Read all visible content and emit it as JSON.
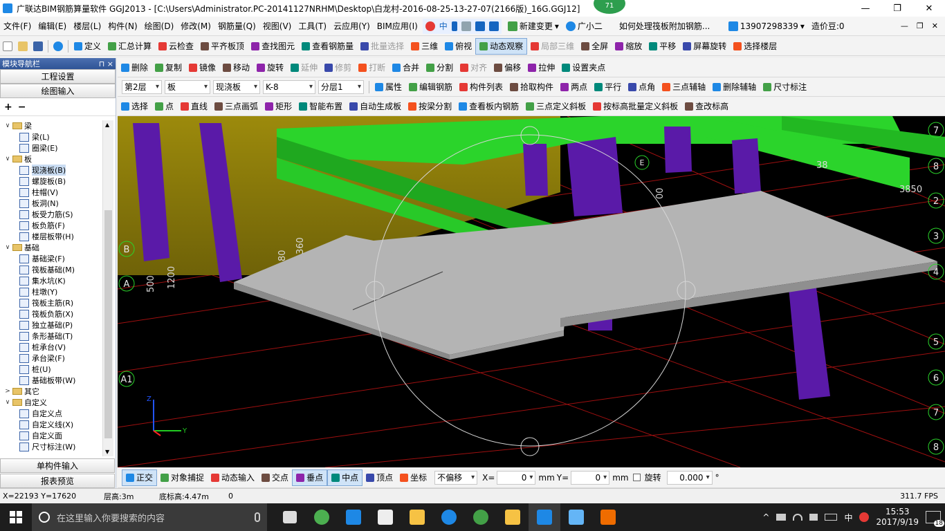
{
  "window": {
    "title": "广联达BIM钢筋算量软件 GGJ2013 - [C:\\Users\\Administrator.PC-20141127NRHM\\Desktop\\白龙村-2016-08-25-13-27-07(2166版)_16G.GGJ12]",
    "badge": "71"
  },
  "menu": {
    "items": [
      "文件(F)",
      "编辑(E)",
      "楼层(L)",
      "构件(N)",
      "绘图(D)",
      "修改(M)",
      "钢筋量(Q)",
      "视图(V)",
      "工具(T)",
      "云应用(Y)",
      "BIM应用(I)"
    ],
    "new_change": "新建变更",
    "assistant": "广小二",
    "question": "如何处理筏板附加钢筋...",
    "phone": "13907298339",
    "beans": "造价豆:0",
    "ime_label": "中"
  },
  "toolbar1": [
    "定义",
    "汇总计算",
    "云检查",
    "平齐板顶",
    "查找图元",
    "查看钢筋量",
    "批量选择",
    "三维",
    "俯视",
    "动态观察",
    "局部三维",
    "全屏",
    "缩放",
    "平移",
    "屏幕旋转",
    "选择楼层"
  ],
  "toolbar2": [
    "删除",
    "复制",
    "镜像",
    "移动",
    "旋转",
    "延伸",
    "修剪",
    "打断",
    "合并",
    "分割",
    "对齐",
    "偏移",
    "拉伸",
    "设置夹点"
  ],
  "toolbar3": {
    "floor": "第2层",
    "category": "板",
    "type": "现浇板",
    "name": "K-8",
    "layer": "分层1",
    "buttons": [
      "属性",
      "编辑钢筋",
      "构件列表",
      "拾取构件",
      "两点",
      "平行",
      "点角",
      "三点辅轴",
      "删除辅轴",
      "尺寸标注"
    ]
  },
  "toolbar4": [
    "选择",
    "点",
    "直线",
    "三点画弧",
    "矩形",
    "智能布置",
    "自动生成板",
    "按梁分割",
    "查看板内钢筋",
    "三点定义斜板",
    "按标高批量定义斜板",
    "查改标高"
  ],
  "nav": {
    "title": "模块导航栏",
    "pin": "⊓ ×",
    "project_settings": "工程设置",
    "drawing_input": "绘图输入",
    "single_input": "单构件输入",
    "report_preview": "报表预览",
    "tree": [
      {
        "level": 0,
        "label": "梁",
        "folder": true,
        "exp": "∨"
      },
      {
        "level": 1,
        "label": "梁(L)"
      },
      {
        "level": 1,
        "label": "圈梁(E)"
      },
      {
        "level": 0,
        "label": "板",
        "folder": true,
        "exp": "∨"
      },
      {
        "level": 1,
        "label": "现浇板(B)",
        "selected": true
      },
      {
        "level": 1,
        "label": "螺旋板(B)"
      },
      {
        "level": 1,
        "label": "柱帽(V)"
      },
      {
        "level": 1,
        "label": "板洞(N)"
      },
      {
        "level": 1,
        "label": "板受力筋(S)"
      },
      {
        "level": 1,
        "label": "板负筋(F)"
      },
      {
        "level": 1,
        "label": "楼层板带(H)"
      },
      {
        "level": 0,
        "label": "基础",
        "folder": true,
        "exp": "∨"
      },
      {
        "level": 1,
        "label": "基础梁(F)"
      },
      {
        "level": 1,
        "label": "筏板基础(M)"
      },
      {
        "level": 1,
        "label": "集水坑(K)"
      },
      {
        "level": 1,
        "label": "柱墩(Y)"
      },
      {
        "level": 1,
        "label": "筏板主筋(R)"
      },
      {
        "level": 1,
        "label": "筏板负筋(X)"
      },
      {
        "level": 1,
        "label": "独立基础(P)"
      },
      {
        "level": 1,
        "label": "条形基础(T)"
      },
      {
        "level": 1,
        "label": "桩承台(V)"
      },
      {
        "level": 1,
        "label": "承台梁(F)"
      },
      {
        "level": 1,
        "label": "桩(U)"
      },
      {
        "level": 1,
        "label": "基础板带(W)"
      },
      {
        "level": 0,
        "label": "其它",
        "folder": true,
        "exp": ">"
      },
      {
        "level": 0,
        "label": "自定义",
        "folder": true,
        "exp": "∨"
      },
      {
        "level": 1,
        "label": "自定义点"
      },
      {
        "level": 1,
        "label": "自定义线(X)"
      },
      {
        "level": 1,
        "label": "自定义面"
      },
      {
        "level": 1,
        "label": "尺寸标注(W)"
      }
    ]
  },
  "viewport": {
    "axis_left": [
      "B",
      "A",
      "A1"
    ],
    "axis_right": [
      "7",
      "8",
      "2",
      "3",
      "4",
      "5",
      "6",
      "7",
      "8"
    ],
    "axis_e": "E",
    "dims": [
      "500",
      "1200",
      "80",
      "360",
      "00",
      "3850",
      "38"
    ]
  },
  "snapbar": {
    "buttons": [
      "正交",
      "对象捕捉",
      "动态输入",
      "交点",
      "垂点",
      "中点",
      "顶点",
      "坐标"
    ],
    "offset": "不偏移",
    "x_label": "X=",
    "x_value": "0",
    "y_label": "Y=",
    "y_value": "0",
    "unit": "mm",
    "rotate_label": "旋转",
    "rotate_value": "0.000",
    "degree": "°"
  },
  "status": {
    "coords": "X=22193 Y=17620",
    "floor_height": "层高:3m",
    "bottom_elev": "底标高:4.47m",
    "zero": "0",
    "fps": "311.7 FPS"
  },
  "taskbar": {
    "search_placeholder": "在这里输入你要搜索的内容",
    "ime": "中",
    "time": "15:53",
    "date": "2017/9/19",
    "notif": "18"
  }
}
